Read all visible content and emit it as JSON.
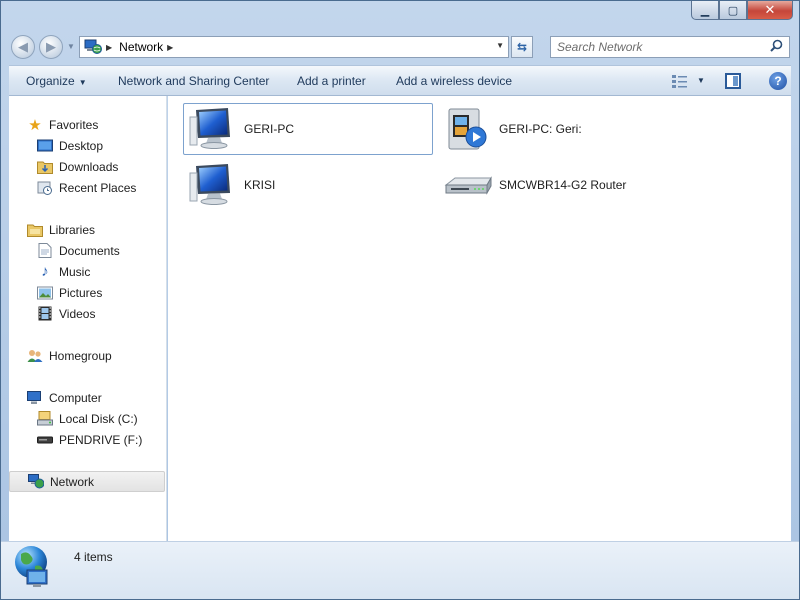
{
  "window": {
    "caption": {
      "minimize": "▁",
      "maximize": "▢",
      "close": "✕"
    }
  },
  "nav": {
    "breadcrumb": [
      "Network"
    ],
    "search_placeholder": "Search Network"
  },
  "toolbar": {
    "organize_label": "Organize",
    "items": [
      "Network and Sharing Center",
      "Add a printer",
      "Add a wireless device"
    ]
  },
  "sidebar": {
    "favorites": {
      "label": "Favorites",
      "items": [
        "Desktop",
        "Downloads",
        "Recent Places"
      ]
    },
    "libraries": {
      "label": "Libraries",
      "items": [
        "Documents",
        "Music",
        "Pictures",
        "Videos"
      ]
    },
    "homegroup": {
      "label": "Homegroup"
    },
    "computer": {
      "label": "Computer",
      "items": [
        "Local Disk (C:)",
        "PENDRIVE (F:)"
      ]
    },
    "network": {
      "label": "Network"
    }
  },
  "content": {
    "items": [
      {
        "label": "GERI-PC",
        "icon": "computer-icon"
      },
      {
        "label": "GERI-PC: Geri:",
        "icon": "media-device-icon"
      },
      {
        "label": "KRISI",
        "icon": "computer-icon"
      },
      {
        "label": "SMCWBR14-G2 Router",
        "icon": "router-icon"
      }
    ]
  },
  "status": {
    "count": "4 items"
  },
  "colors": {
    "accent": "#2d63a6",
    "selection_border": "#7da2ce",
    "chrome": "#b9d1ea"
  }
}
